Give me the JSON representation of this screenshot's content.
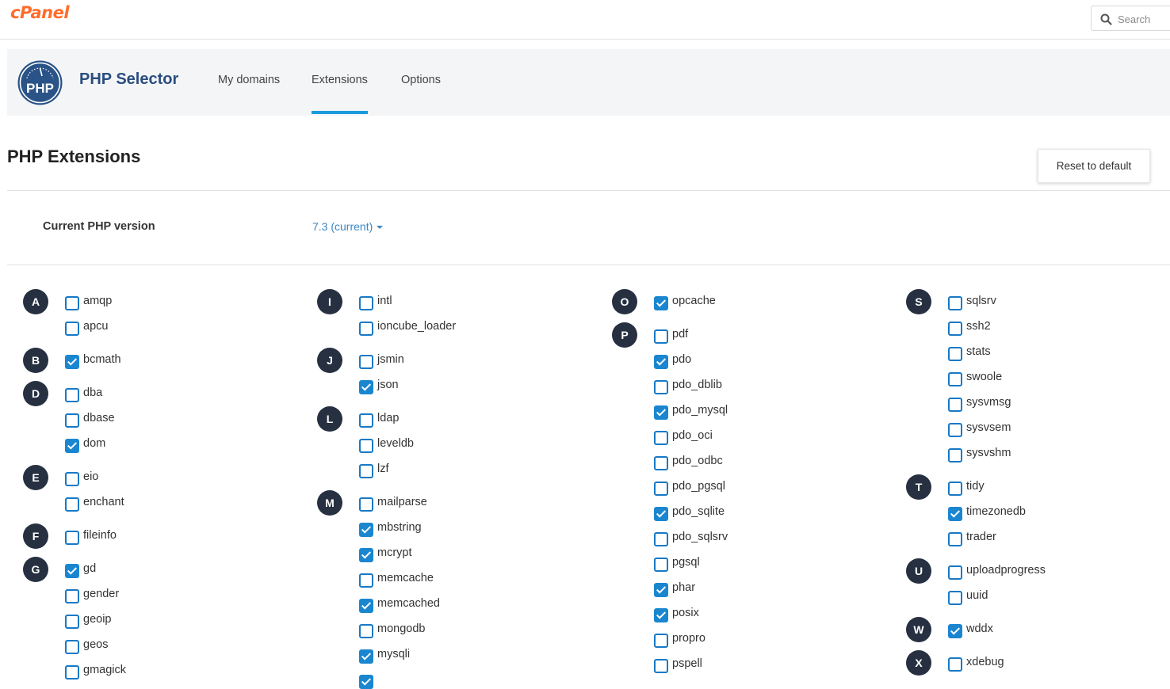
{
  "topbar": {
    "logo": "cPanel",
    "search_placeholder": "Search"
  },
  "header": {
    "logo_text": "PHP",
    "title": "PHP Selector",
    "tabs": [
      {
        "label": "My domains",
        "active": false
      },
      {
        "label": "Extensions",
        "active": true
      },
      {
        "label": "Options",
        "active": false
      }
    ]
  },
  "page": {
    "title": "PHP Extensions",
    "reset_label": "Reset to default"
  },
  "version": {
    "label": "Current PHP version",
    "value": "7.3 (current)"
  },
  "colors": {
    "accent": "#1a86d0",
    "brand": "#ff6c2c",
    "title": "#2a4d7e",
    "badge": "#263040"
  },
  "extensions": [
    [
      {
        "letter": "A",
        "items": [
          {
            "name": "amqp",
            "checked": false
          },
          {
            "name": "apcu",
            "checked": false
          }
        ]
      },
      {
        "letter": "B",
        "items": [
          {
            "name": "bcmath",
            "checked": true
          }
        ]
      },
      {
        "letter": "D",
        "items": [
          {
            "name": "dba",
            "checked": false
          },
          {
            "name": "dbase",
            "checked": false
          },
          {
            "name": "dom",
            "checked": true
          }
        ]
      },
      {
        "letter": "E",
        "items": [
          {
            "name": "eio",
            "checked": false
          },
          {
            "name": "enchant",
            "checked": false
          }
        ]
      },
      {
        "letter": "F",
        "items": [
          {
            "name": "fileinfo",
            "checked": false
          }
        ]
      },
      {
        "letter": "G",
        "items": [
          {
            "name": "gd",
            "checked": true
          },
          {
            "name": "gender",
            "checked": false
          },
          {
            "name": "geoip",
            "checked": false
          },
          {
            "name": "geos",
            "checked": false
          },
          {
            "name": "gmagick",
            "checked": false
          }
        ]
      }
    ],
    [
      {
        "letter": "I",
        "items": [
          {
            "name": "intl",
            "checked": false
          },
          {
            "name": "ioncube_loader",
            "checked": false
          }
        ]
      },
      {
        "letter": "J",
        "items": [
          {
            "name": "jsmin",
            "checked": false
          },
          {
            "name": "json",
            "checked": true
          }
        ]
      },
      {
        "letter": "L",
        "items": [
          {
            "name": "ldap",
            "checked": false
          },
          {
            "name": "leveldb",
            "checked": false
          },
          {
            "name": "lzf",
            "checked": false
          }
        ]
      },
      {
        "letter": "M",
        "items": [
          {
            "name": "mailparse",
            "checked": false
          },
          {
            "name": "mbstring",
            "checked": true
          },
          {
            "name": "mcrypt",
            "checked": true
          },
          {
            "name": "memcache",
            "checked": false
          },
          {
            "name": "memcached",
            "checked": true
          },
          {
            "name": "mongodb",
            "checked": false
          },
          {
            "name": "mysqli",
            "checked": true
          },
          {
            "name": "",
            "checked": true
          }
        ]
      }
    ],
    [
      {
        "letter": "O",
        "items": [
          {
            "name": "opcache",
            "checked": true
          }
        ]
      },
      {
        "letter": "P",
        "items": [
          {
            "name": "pdf",
            "checked": false
          },
          {
            "name": "pdo",
            "checked": true
          },
          {
            "name": "pdo_dblib",
            "checked": false
          },
          {
            "name": "pdo_mysql",
            "checked": true
          },
          {
            "name": "pdo_oci",
            "checked": false
          },
          {
            "name": "pdo_odbc",
            "checked": false
          },
          {
            "name": "pdo_pgsql",
            "checked": false
          },
          {
            "name": "pdo_sqlite",
            "checked": true
          },
          {
            "name": "pdo_sqlsrv",
            "checked": false
          },
          {
            "name": "pgsql",
            "checked": false
          },
          {
            "name": "phar",
            "checked": true
          },
          {
            "name": "posix",
            "checked": true
          },
          {
            "name": "propro",
            "checked": false
          },
          {
            "name": "pspell",
            "checked": false
          }
        ]
      }
    ],
    [
      {
        "letter": "S",
        "items": [
          {
            "name": "sqlsrv",
            "checked": false
          },
          {
            "name": "ssh2",
            "checked": false
          },
          {
            "name": "stats",
            "checked": false
          },
          {
            "name": "swoole",
            "checked": false
          },
          {
            "name": "sysvmsg",
            "checked": false
          },
          {
            "name": "sysvsem",
            "checked": false
          },
          {
            "name": "sysvshm",
            "checked": false
          }
        ]
      },
      {
        "letter": "T",
        "items": [
          {
            "name": "tidy",
            "checked": false
          },
          {
            "name": "timezonedb",
            "checked": true
          },
          {
            "name": "trader",
            "checked": false
          }
        ]
      },
      {
        "letter": "U",
        "items": [
          {
            "name": "uploadprogress",
            "checked": false
          },
          {
            "name": "uuid",
            "checked": false
          }
        ]
      },
      {
        "letter": "W",
        "items": [
          {
            "name": "wddx",
            "checked": true
          }
        ]
      },
      {
        "letter": "X",
        "items": [
          {
            "name": "xdebug",
            "checked": false
          }
        ]
      }
    ]
  ]
}
